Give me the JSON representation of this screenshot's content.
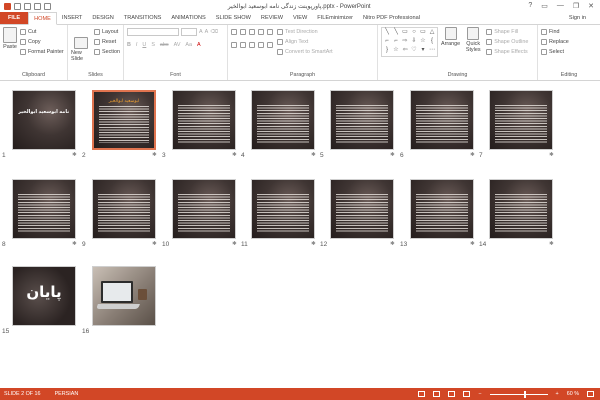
{
  "window": {
    "title": "پاورپوینت زندگی نامه ابوسعید ابوالخیر.pptx - PowerPoint",
    "controls": [
      "?",
      "▭",
      "—",
      "❐",
      "✕"
    ]
  },
  "tabs": [
    {
      "label": "FILE"
    },
    {
      "label": "HOME"
    },
    {
      "label": "INSERT"
    },
    {
      "label": "DESIGN"
    },
    {
      "label": "TRANSITIONS"
    },
    {
      "label": "ANIMATIONS"
    },
    {
      "label": "SLIDE SHOW"
    },
    {
      "label": "REVIEW"
    },
    {
      "label": "VIEW"
    },
    {
      "label": "FILEminimizer"
    },
    {
      "label": "Nitro PDF Professional"
    }
  ],
  "signin": "Sign in",
  "ribbon": {
    "clipboard": {
      "label": "Clipboard",
      "paste": "Paste",
      "cut": "Cut",
      "copy": "Copy",
      "format_painter": "Format Painter"
    },
    "slides": {
      "label": "Slides",
      "new_slide": "New Slide",
      "layout": "Layout",
      "reset": "Reset",
      "section": "Section"
    },
    "font": {
      "label": "Font",
      "bold": "B",
      "italic": "I",
      "underline": "U",
      "strike": "S",
      "abc": "abc",
      "spacing": "AV",
      "case": "Aa",
      "color": "A"
    },
    "paragraph": {
      "label": "Paragraph",
      "text_direction": "Text Direction",
      "align_text": "Align Text",
      "convert": "Convert to SmartArt"
    },
    "drawing": {
      "label": "Drawing",
      "arrange": "Arrange",
      "quick_styles": "Quick Styles",
      "shape_fill": "Shape Fill",
      "shape_outline": "Shape Outline",
      "shape_effects": "Shape Effects"
    },
    "editing": {
      "label": "Editing",
      "find": "Find",
      "replace": "Replace",
      "select": "Select"
    }
  },
  "slides": [
    {
      "number": "1",
      "title": "زندگی نامه ابوسعید ابوالخیر",
      "style": "cover",
      "selected": false
    },
    {
      "number": "2",
      "title": "ابوسعید ابوالخیر",
      "style": "text",
      "selected": true
    },
    {
      "number": "3",
      "title": "",
      "style": "text",
      "selected": false
    },
    {
      "number": "4",
      "title": "",
      "style": "text",
      "selected": false
    },
    {
      "number": "5",
      "title": "",
      "style": "text",
      "selected": false
    },
    {
      "number": "6",
      "title": "",
      "style": "text",
      "selected": false
    },
    {
      "number": "7",
      "title": "",
      "style": "text",
      "selected": false
    },
    {
      "number": "8",
      "title": "",
      "style": "text",
      "selected": false
    },
    {
      "number": "9",
      "title": "",
      "style": "text",
      "selected": false
    },
    {
      "number": "10",
      "title": "",
      "style": "text",
      "selected": false
    },
    {
      "number": "11",
      "title": "",
      "style": "text",
      "selected": false
    },
    {
      "number": "12",
      "title": "",
      "style": "text",
      "selected": false
    },
    {
      "number": "13",
      "title": "",
      "style": "text",
      "selected": false
    },
    {
      "number": "14",
      "title": "",
      "style": "text",
      "selected": false
    },
    {
      "number": "15",
      "title": "پایان",
      "style": "end",
      "selected": false
    },
    {
      "number": "16",
      "title": "",
      "style": "photo",
      "selected": false
    }
  ],
  "status": {
    "slide_info": "SLIDE 2 OF 16",
    "language": "PERSIAN",
    "zoom": "60 %",
    "zoom_level": 0.6
  },
  "colors": {
    "accent": "#d24726",
    "selection": "#e0744f"
  }
}
